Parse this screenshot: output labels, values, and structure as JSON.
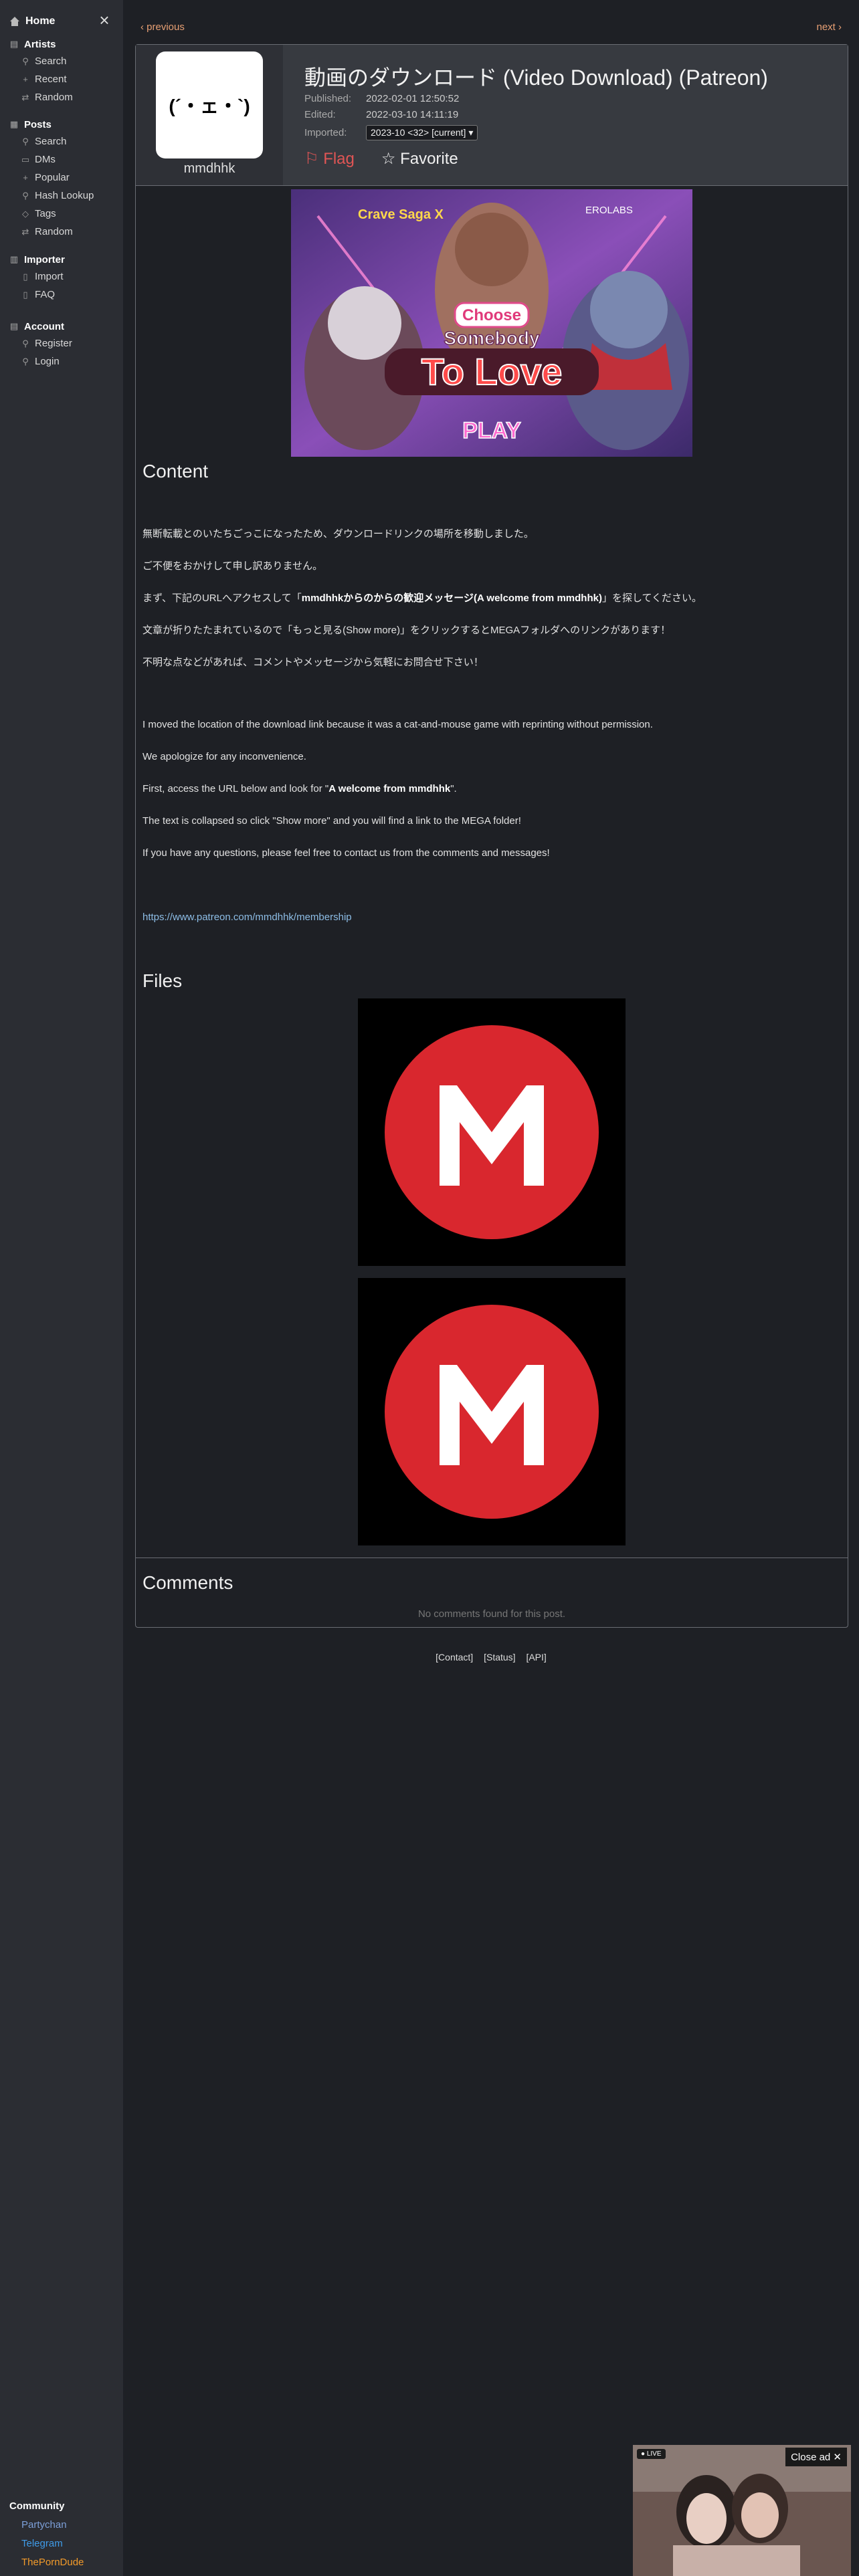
{
  "sidebar": {
    "home": "Home",
    "sections": [
      {
        "title": "Artists",
        "items": [
          "Search",
          "Recent",
          "Random"
        ]
      },
      {
        "title": "Posts",
        "items": [
          "Search",
          "DMs",
          "Popular",
          "Hash Lookup",
          "Tags",
          "Random"
        ]
      },
      {
        "title": "Importer",
        "items": [
          "Import",
          "FAQ"
        ]
      },
      {
        "title": "Account",
        "items": [
          "Register",
          "Login"
        ]
      }
    ],
    "community": {
      "title": "Community",
      "links": [
        {
          "label": "Partychan",
          "color": "#7c9fd8"
        },
        {
          "label": "Telegram",
          "color": "#3f9be8"
        },
        {
          "label": "ThePornDude",
          "color": "#f29a2a"
        }
      ]
    }
  },
  "nav": {
    "previous": "‹ previous",
    "next": "next ›"
  },
  "post": {
    "artist": "mmdhhk",
    "avatar_text": "(´・ェ・`)",
    "title": "動画のダウンロード (Video Download) (Patreon)",
    "published_label": "Published:",
    "published": "2022-02-01 12:50:52",
    "edited_label": "Edited:",
    "edited": "2022-03-10 14:11:19",
    "imported_label": "Imported:",
    "imported_option": "2023-10 <32> [current]",
    "flag": "Flag",
    "favorite": "Favorite",
    "banner": {
      "brand": "Crave Saga X",
      "studio": "EROLABS",
      "line1": "Choose",
      "line2": "Somebody",
      "line3": "To Love",
      "cta": "PLAY"
    },
    "content_heading": "Content",
    "jp_1": "無断転載とのいたちごっこになったため、ダウンロードリンクの場所を移動しました。",
    "jp_2": "ご不便をおかけして申し訳ありません。",
    "jp_3a": "まず、下記のURLへアクセスして「",
    "jp_3b": "mmdhhkからのからの歓迎メッセージ(A welcome from mmdhhk)",
    "jp_3c": "」を探してください。",
    "jp_4": "文章が折りたたまれているので「もっと見る(Show more)」をクリックするとMEGAフォルダへのリンクがあります！",
    "jp_5": "不明な点などがあれば、コメントやメッセージから気軽にお問合せ下さい！",
    "en_1": "I moved the location of the download link because it was a cat-and-mouse game with reprinting without permission.",
    "en_2": "We apologize for any inconvenience.",
    "en_3a": "First, access the URL below and look for \"",
    "en_3b": "A welcome from mmdhhk",
    "en_3c": "\".",
    "en_4": "The text is collapsed so click \"Show more\" and you will find a link to the MEGA folder!",
    "en_5": "If you have any questions, please feel free to contact us from the comments and messages!",
    "link": "https://www.patreon.com/mmdhhk/membership",
    "files_heading": "Files",
    "file_letter": "M",
    "comments_heading": "Comments",
    "no_comments": "No comments found for this post."
  },
  "footer": [
    "[Contact]",
    "[Status]",
    "[API]"
  ],
  "ad": {
    "live": "● LIVE",
    "close": "Close ad ✕"
  },
  "colors": {
    "accent": "#e8a074",
    "mega_red": "#d9272e",
    "link": "#8dbde6"
  }
}
